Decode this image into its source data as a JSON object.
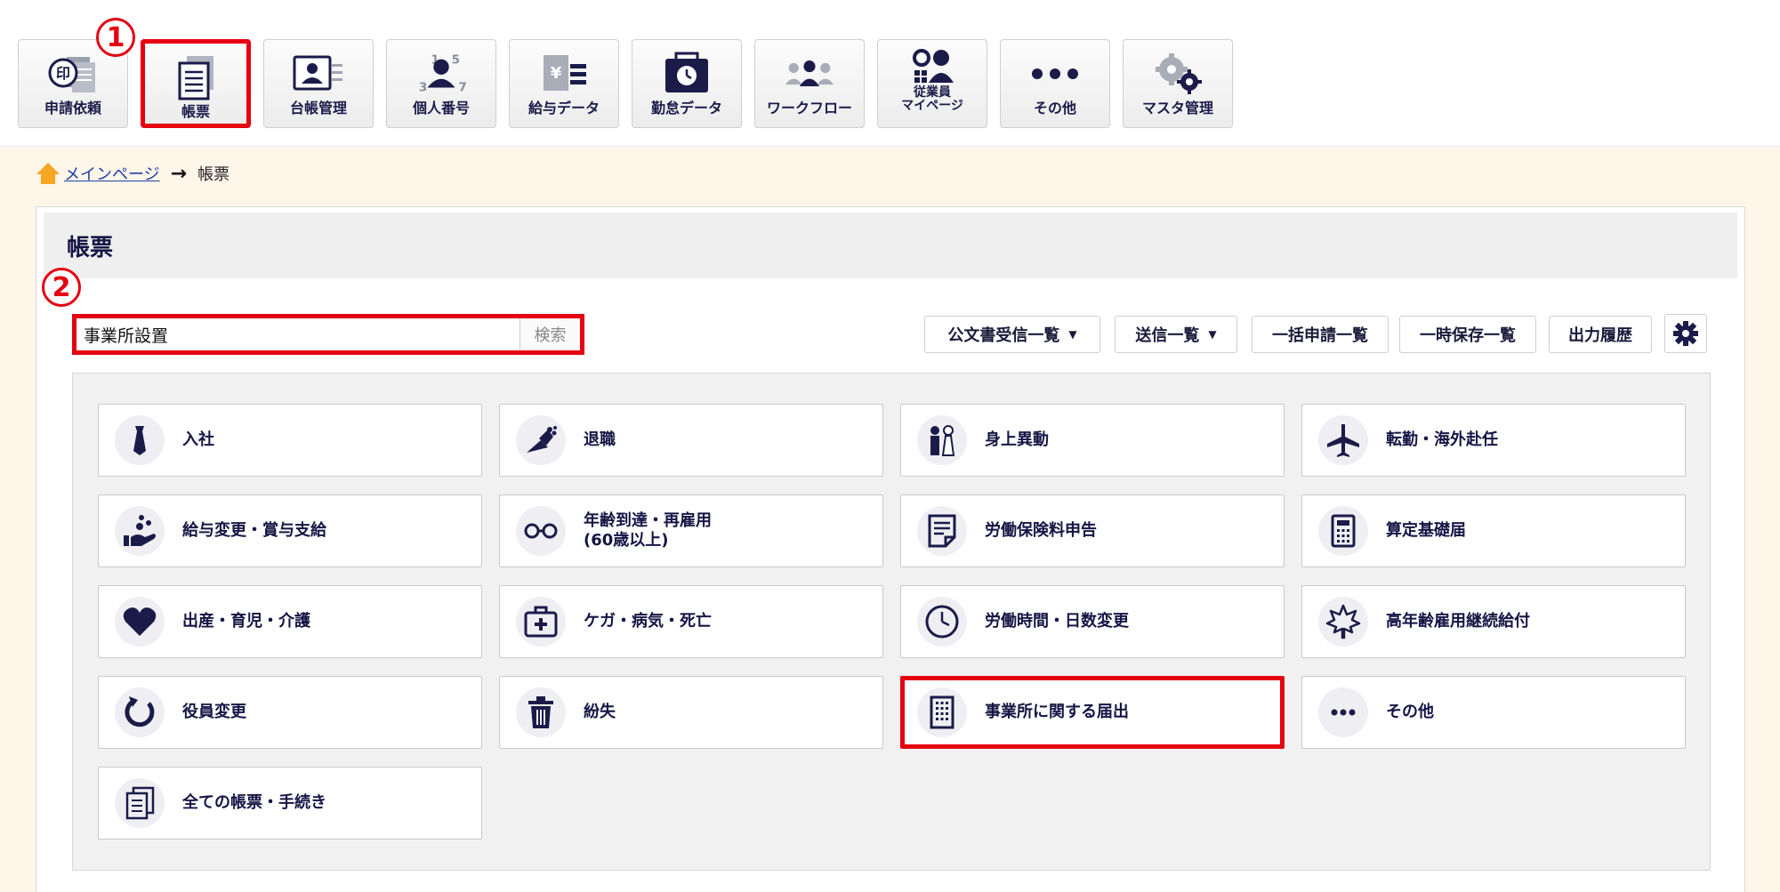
{
  "nav": {
    "items": [
      {
        "label": "申請依頼",
        "icon": "stamp-document-icon"
      },
      {
        "label": "帳票",
        "icon": "form-document-icon",
        "active": true
      },
      {
        "label": "台帳管理",
        "icon": "id-card-icon"
      },
      {
        "label": "個人番号",
        "icon": "personal-number-icon"
      },
      {
        "label": "給与データ",
        "icon": "salary-data-icon"
      },
      {
        "label": "勤怠データ",
        "icon": "attendance-clock-icon"
      },
      {
        "label": "ワークフロー",
        "icon": "workflow-people-icon"
      },
      {
        "label": "従業員\nマイページ",
        "icon": "employee-mypage-icon"
      },
      {
        "label": "その他",
        "icon": "more-dots-icon"
      },
      {
        "label": "マスタ管理",
        "icon": "master-gears-icon"
      }
    ]
  },
  "annotations": {
    "step1": "1",
    "step2": "2"
  },
  "breadcrumb": {
    "home": "メインページ",
    "current": "帳票"
  },
  "page": {
    "title": "帳票"
  },
  "search": {
    "value": "事業所設置",
    "button": "検索"
  },
  "toolbar": {
    "official_inbox": "公文書受信一覧",
    "sent_list": "送信一覧",
    "bulk_apply": "一括申請一覧",
    "temp_saved": "一時保存一覧",
    "output_history": "出力履歴"
  },
  "categories": [
    {
      "label": "入社",
      "icon": "necktie-icon"
    },
    {
      "label": "退職",
      "icon": "bouquet-icon"
    },
    {
      "label": "身上異動",
      "icon": "wedding-couple-icon"
    },
    {
      "label": "転勤・海外赴任",
      "icon": "airplane-icon"
    },
    {
      "label": "給与変更・賞与支給",
      "icon": "hand-coins-icon"
    },
    {
      "label": "年齢到達・再雇用\n(60歳以上)",
      "icon": "glasses-icon"
    },
    {
      "label": "労働保険料申告",
      "icon": "note-document-icon"
    },
    {
      "label": "算定基礎届",
      "icon": "calculator-icon"
    },
    {
      "label": "出産・育児・介護",
      "icon": "heart-icon"
    },
    {
      "label": "ケガ・病気・死亡",
      "icon": "first-aid-kit-icon"
    },
    {
      "label": "労働時間・日数変更",
      "icon": "clock-icon"
    },
    {
      "label": "高年齢雇用継続給付",
      "icon": "maple-leaf-icon"
    },
    {
      "label": "役員変更",
      "icon": "refresh-icon"
    },
    {
      "label": "紛失",
      "icon": "trash-icon"
    },
    {
      "label": "事業所に関する届出",
      "icon": "building-icon",
      "highlighted": true
    },
    {
      "label": "その他",
      "icon": "more-dots-icon"
    },
    {
      "label": "全ての帳票・手続き",
      "icon": "documents-icon"
    }
  ],
  "colors": {
    "accent_red": "#e50012",
    "navy": "#151545",
    "page_bg": "#fff6ea"
  }
}
